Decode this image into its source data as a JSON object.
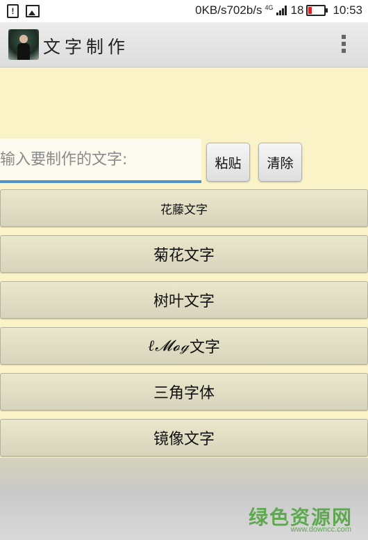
{
  "status_bar": {
    "speed": "0KB/s702b/s",
    "network": "4G",
    "battery_level": "18",
    "time": "10:53"
  },
  "app_bar": {
    "title": "文字制作"
  },
  "input": {
    "placeholder": "输入要制作的文字:",
    "value": ""
  },
  "buttons": {
    "paste": "粘贴",
    "clear": "清除"
  },
  "menu": {
    "items": [
      {
        "label": "花藤文字"
      },
      {
        "label": "菊花文字"
      },
      {
        "label": "树叶文字"
      },
      {
        "label_fancy": "ℓ𝓜𝓸ℊ",
        "label_suffix": "文字"
      },
      {
        "label": "三角字体"
      },
      {
        "label": "镜像文字"
      }
    ]
  },
  "watermark": {
    "title": "绿色资源网",
    "url": "www.downcc.com"
  },
  "colors": {
    "background": "#fbf3c8",
    "underline": "#4f93c5",
    "watermark": "#4aa23a"
  }
}
